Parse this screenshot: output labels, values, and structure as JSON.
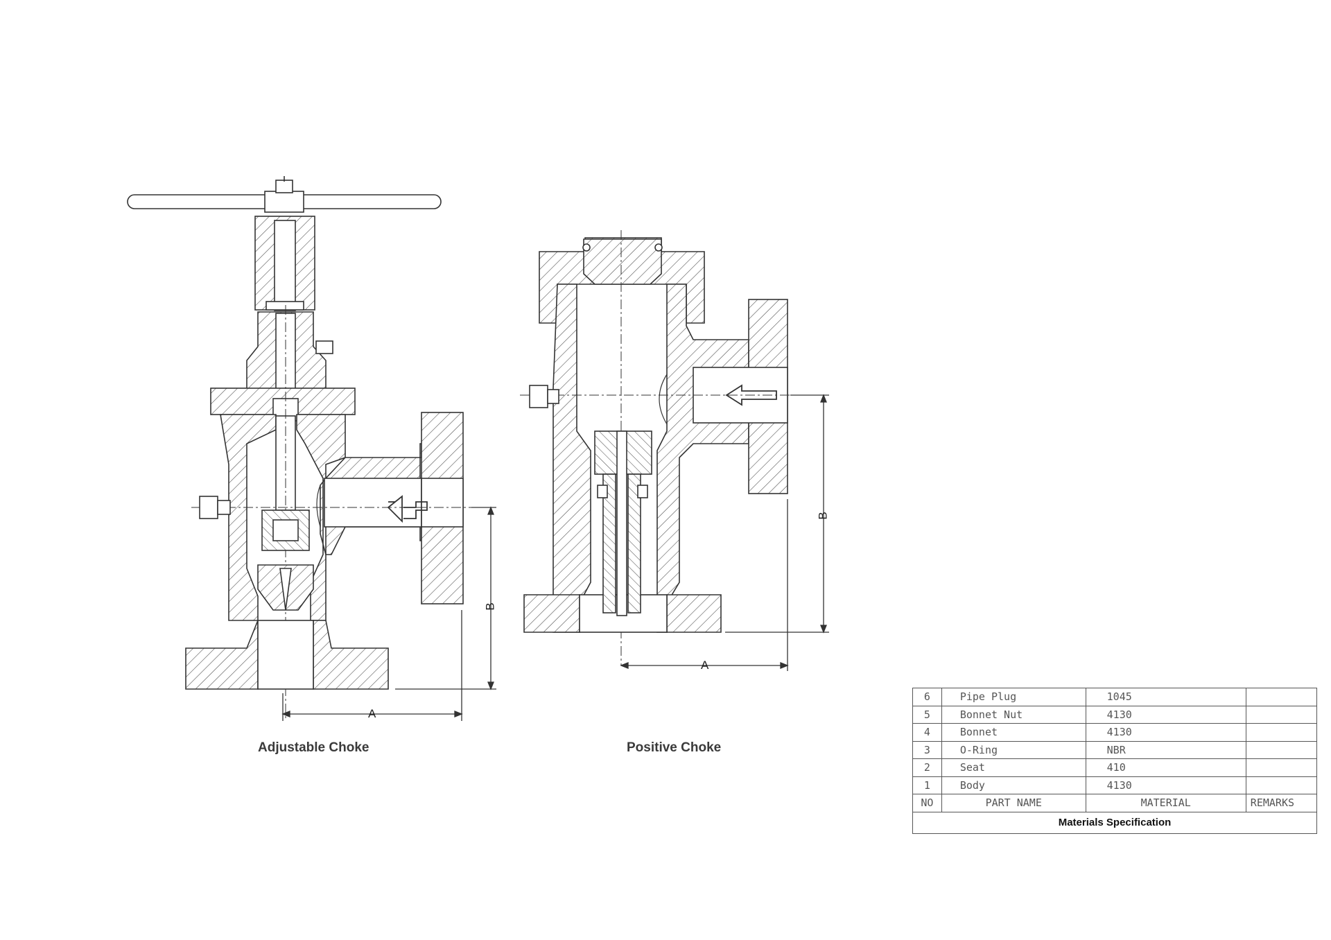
{
  "captions": {
    "adjustable": "Adjustable Choke",
    "positive": "Positive Choke"
  },
  "dimensions": {
    "a": "A",
    "b": "B"
  },
  "parts_table": {
    "rows": [
      {
        "no": "6",
        "name": "Pipe Plug",
        "material": "1045",
        "remarks": ""
      },
      {
        "no": "5",
        "name": "Bonnet Nut",
        "material": "4130",
        "remarks": ""
      },
      {
        "no": "4",
        "name": "Bonnet",
        "material": "4130",
        "remarks": ""
      },
      {
        "no": "3",
        "name": "O-Ring",
        "material": "NBR",
        "remarks": ""
      },
      {
        "no": "2",
        "name": "Seat",
        "material": "410",
        "remarks": ""
      },
      {
        "no": "1",
        "name": "Body",
        "material": "4130",
        "remarks": ""
      }
    ],
    "header": {
      "no": "NO",
      "name": "PART NAME",
      "material": "MATERIAL",
      "remarks": "REMARKS"
    },
    "title": "Materials Specification"
  }
}
